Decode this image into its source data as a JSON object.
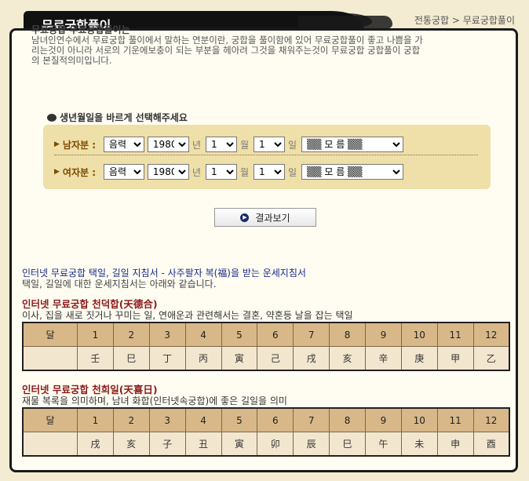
{
  "header": {
    "title": "무료궁합풀이"
  },
  "breadcrumb": {
    "parent": "전통궁합",
    "separator": ">",
    "current": "무료궁합풀이"
  },
  "intro": {
    "title": "무료궁합 무료궁합풀이는",
    "lines": [
      "남녀인연수에서 무료궁합 풀이에서 말하는 연분이란, 궁합을 풀이함에 있어 무료궁합풀이 좋고 나쁨을 가",
      "리는것이 아니라 서로의 기운에보충이 되는 부분을 헤아려 그것을 채워주는것이 무료궁합 궁합풀이 궁합",
      "의 본질적의미입니다."
    ]
  },
  "select_heading": "생년월일을 바르게 선택해주세요",
  "form": {
    "man": {
      "label": "남자분 :",
      "calendar": "음력",
      "year": "1980",
      "month": "1",
      "day": "1",
      "hour": "▒▒ 모 름 ▒▒"
    },
    "woman": {
      "label": "여자분 :",
      "calendar": "음력",
      "year": "1980",
      "month": "1",
      "day": "1",
      "hour": "▒▒ 모 름 ▒▒"
    },
    "units": {
      "year": "년",
      "month": "월",
      "day": "일"
    }
  },
  "result_button": {
    "label": "결과보기"
  },
  "guide": {
    "title": "인터넷 무료궁합 택일, 길일 지침서 - 사주팔자 복(福)을 받는 운세지침서",
    "text": "택일, 길일에 대한 운세지침서는 아래와 같습니다."
  },
  "section1": {
    "title": "인터넷 무료궁합 천덕합(天德合)",
    "desc": "이사, 집을 새로 짓거나 꾸미는 일, 연애운과 관련해서는 결혼, 약혼등 날을 잡는 택일",
    "header_label": "달",
    "months": [
      "1",
      "2",
      "3",
      "4",
      "5",
      "6",
      "7",
      "8",
      "9",
      "10",
      "11",
      "12"
    ],
    "values": [
      "壬",
      "巳",
      "丁",
      "丙",
      "寅",
      "己",
      "戌",
      "亥",
      "辛",
      "庚",
      "甲",
      "乙"
    ]
  },
  "section2": {
    "title": "인터넷 무료궁합 천희일(天喜日)",
    "desc": "재물 복록을 의미하며, 남녀 화합(인터넷속궁합)에 좋은 길일을 의미",
    "header_label": "달",
    "months": [
      "1",
      "2",
      "3",
      "4",
      "5",
      "6",
      "7",
      "8",
      "9",
      "10",
      "11",
      "12"
    ],
    "values": [
      "戌",
      "亥",
      "子",
      "丑",
      "寅",
      "卯",
      "辰",
      "巳",
      "午",
      "未",
      "申",
      "酉"
    ]
  },
  "colors": {
    "background": "#f3ecd3",
    "panel_border": "#1a1a1a",
    "form_bg": "#efdfa8",
    "table_header": "#d8b888",
    "table_value": "#f3e6cf",
    "section_title": "#8b1a1a",
    "guide_title": "#1a2a8a"
  }
}
